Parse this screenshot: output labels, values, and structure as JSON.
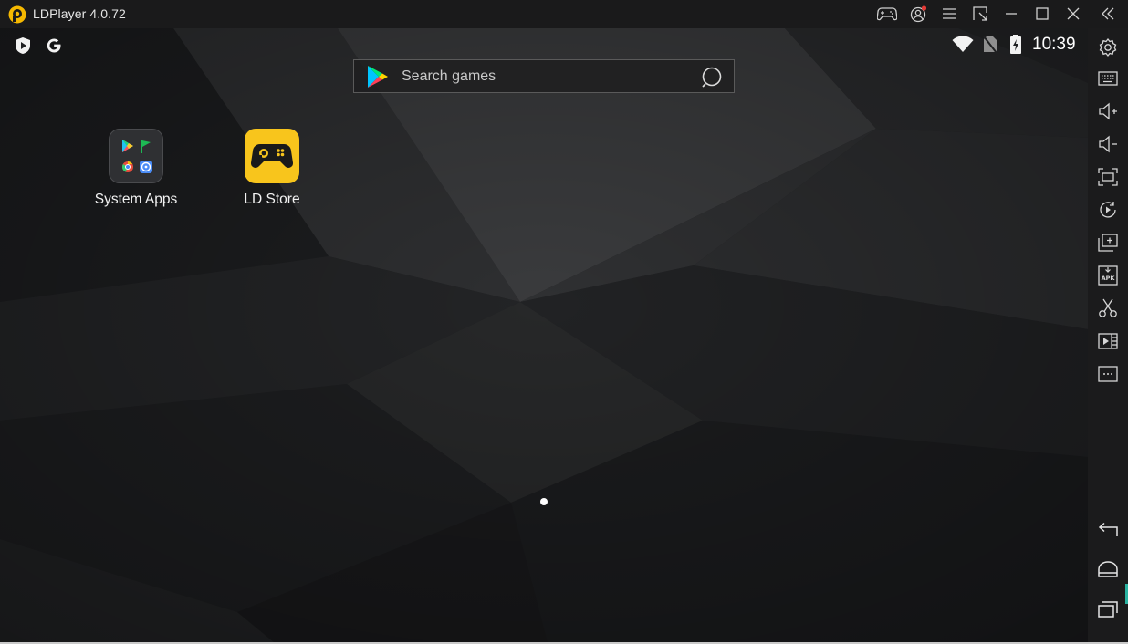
{
  "window": {
    "title": "LDPlayer 4.0.72",
    "logo_icon": "ldplayer-logo-icon",
    "controls": [
      "gamepad-icon",
      "account-icon",
      "menu-icon",
      "resize-icon",
      "minimize-icon",
      "maximize-icon",
      "close-icon",
      "collapse-sidebar-icon"
    ]
  },
  "status_bar": {
    "left_icons": [
      "play-protect-icon",
      "google-icon"
    ],
    "right_icons": [
      "wifi-icon",
      "no-sim-icon",
      "battery-charging-icon"
    ],
    "time": "10:39"
  },
  "search": {
    "placeholder": "Search games",
    "icon_left": "play-store-icon",
    "icon_right": "search-icon"
  },
  "home": {
    "apps": [
      {
        "label": "System Apps",
        "icon": "system-apps-folder-icon"
      },
      {
        "label": "LD Store",
        "icon": "ld-store-gamepad-icon"
      }
    ],
    "page_indicator": {
      "pages": 1,
      "current": 1
    }
  },
  "sidebar": {
    "tools": [
      "settings-icon",
      "keyboard-mapping-icon",
      "volume-up-icon",
      "volume-down-icon",
      "screenshot-icon",
      "record-operation-icon",
      "multi-instance-icon",
      "install-apk-icon",
      "cut-icon",
      "video-record-icon",
      "more-icon"
    ],
    "nav": [
      "back-icon",
      "home-icon",
      "recent-apps-icon"
    ]
  },
  "colors": {
    "titlebar": "#1a1a1b",
    "sidebar": "#1b1b1c",
    "wallpaper": "#1e1f21",
    "ld_store": "#f8c51c",
    "accent_teal": "#2ab3a1",
    "notification_dot": "#e53935"
  }
}
